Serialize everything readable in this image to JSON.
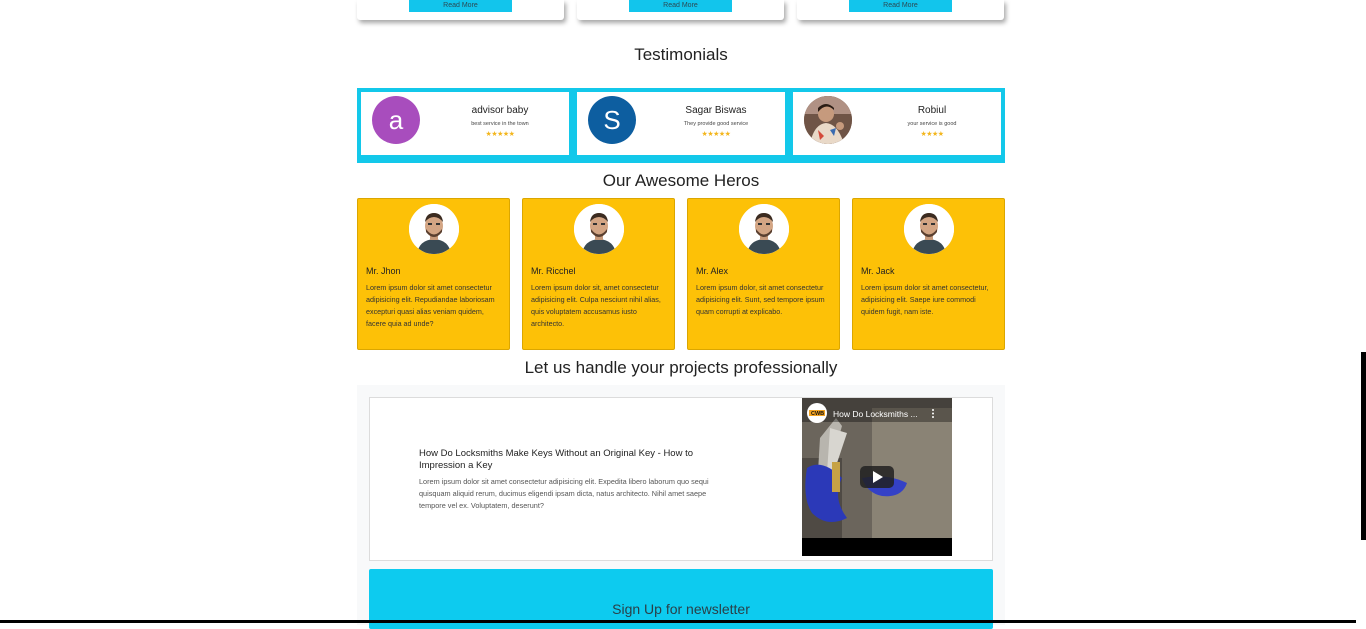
{
  "services": {
    "cards": [
      {
        "button": "Read More"
      },
      {
        "button": "Read More"
      },
      {
        "button": "Read More"
      }
    ]
  },
  "testimonials": {
    "title": "Testimonials",
    "items": [
      {
        "initial": "a",
        "avatar_color": "#a84dbd",
        "name": "advisor baby",
        "text": "best service in the town",
        "stars": "★★★★★",
        "rating": 5
      },
      {
        "initial": "S",
        "avatar_color": "#0d5ea0",
        "name": "Sagar Biswas",
        "text": "They provide good service",
        "stars": "★★★★★",
        "rating": 5
      },
      {
        "initial": "",
        "avatar_color": "#7a5a4a",
        "name": "Robiul",
        "text": "your service is good",
        "stars": "★★★★",
        "rating": 4
      }
    ]
  },
  "heroes": {
    "title": "Our Awesome Heros",
    "items": [
      {
        "name": "Mr. Jhon",
        "desc": "Lorem ipsum dolor sit amet consectetur adipisicing elit. Repudiandae laboriosam excepturi quasi alias veniam quidem, facere quia ad unde?"
      },
      {
        "name": "Mr. Ricchel",
        "desc": "Lorem ipsum dolor sit, amet consectetur adipisicing elit. Culpa nesciunt nihil alias, quis voluptatem accusamus iusto architecto."
      },
      {
        "name": "Mr. Alex",
        "desc": "Lorem ipsum dolor, sit amet consectetur adipisicing elit. Sunt, sed tempore ipsum quam corrupti at explicabo."
      },
      {
        "name": "Mr. Jack",
        "desc": "Lorem ipsum dolor sit amet consectetur, adipisicing elit. Saepe iure commodi quidem fugit, nam iste."
      }
    ]
  },
  "projects": {
    "title": "Let us handle your projects professionally",
    "article_title": "How Do Locksmiths Make Keys Without an Original Key - How to Impression a Key",
    "article_desc": "Lorem ipsum dolor sit amet consectetur adipisicing elit. Expedita libero laborum quo sequi quisquam aliquid rerum, ducimus eligendi ipsam dicta, natus architecto. Nihil amet saepe tempore vel ex. Voluptatem, deserunt?",
    "video_title": "How Do Locksmiths ...",
    "channel_badge": "CWB"
  },
  "newsletter": {
    "title": "Sign Up for newsletter"
  },
  "colors": {
    "accent_cyan": "#13c8ea",
    "hero_yellow": "#fdc107",
    "star": "#f3b61d"
  }
}
